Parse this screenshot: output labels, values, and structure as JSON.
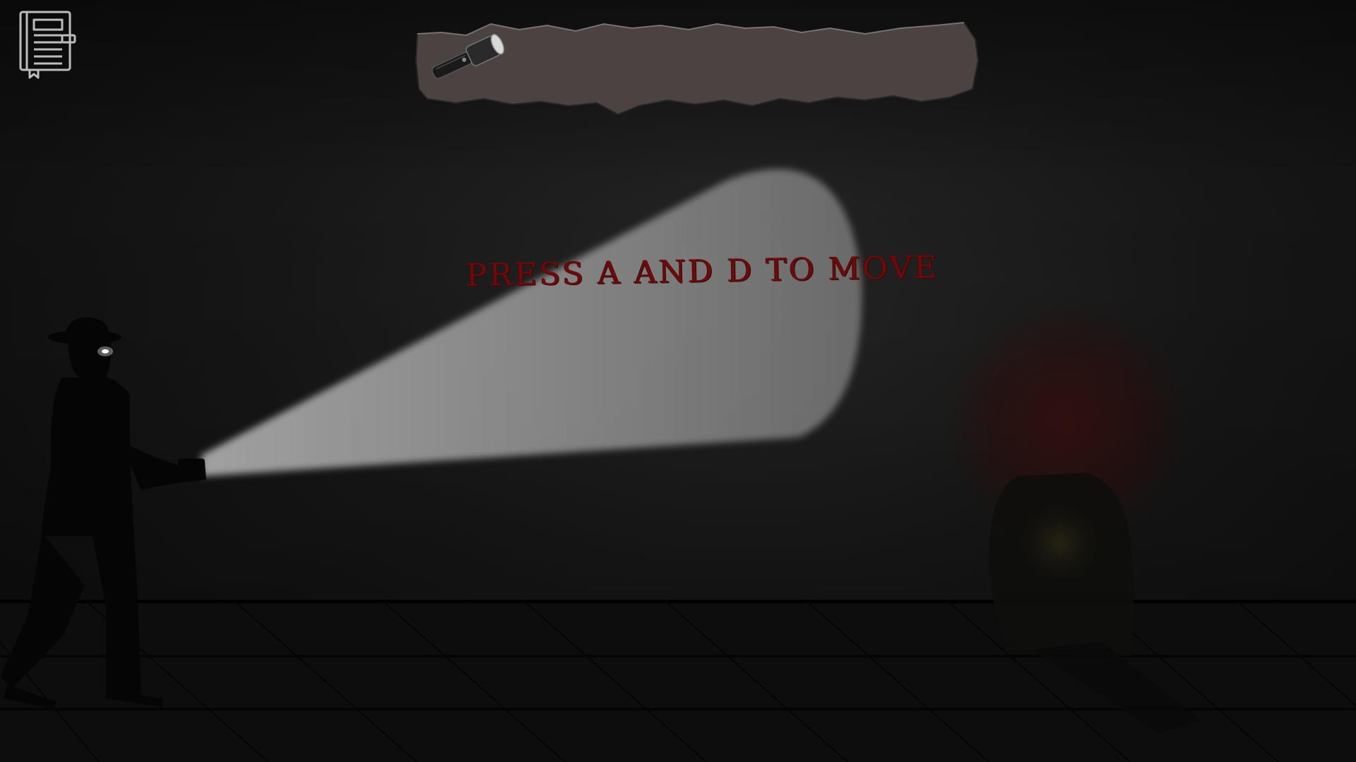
{
  "hud": {
    "journal_icon": "journal-icon",
    "inventory": {
      "items": [
        {
          "icon": "flashlight-icon",
          "selected": true
        }
      ]
    }
  },
  "hint": {
    "text": "PRESS A AND D TO MOVE",
    "color": "#6a0c0c"
  },
  "scene": {
    "wall_color": "#1a1a1a",
    "floor_color": "#0d0d0d",
    "beam_color": "#9a9a9a",
    "blood_color": "#460808"
  }
}
